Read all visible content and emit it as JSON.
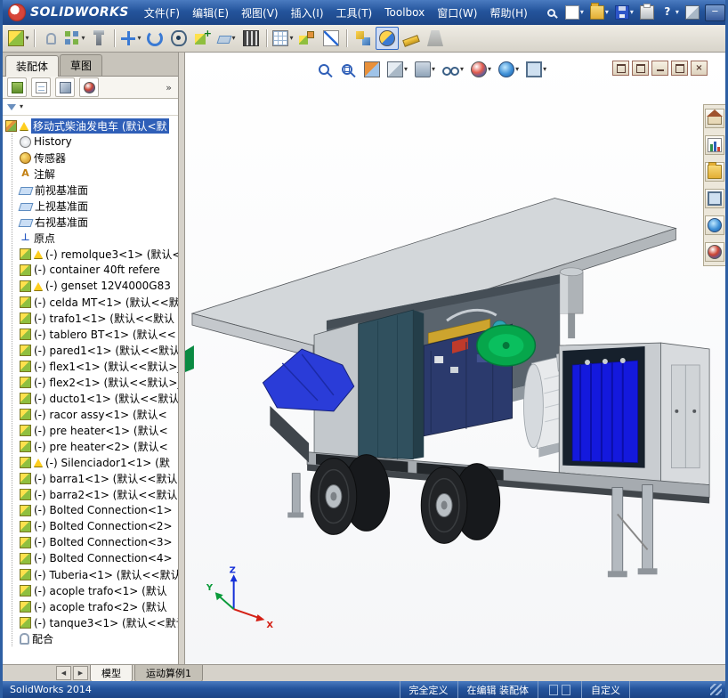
{
  "window": {
    "brand": "SOLIDWORKS",
    "menus": [
      "文件(F)",
      "编辑(E)",
      "视图(V)",
      "插入(I)",
      "工具(T)",
      "Toolbox",
      "窗口(W)",
      "帮助(H)"
    ],
    "quick_icons": [
      {
        "name": "search-icon",
        "kind": "search"
      },
      {
        "name": "new-document-icon",
        "kind": "page",
        "caret": true
      },
      {
        "name": "open-file-icon",
        "kind": "folder",
        "caret": true
      },
      {
        "name": "save-icon",
        "kind": "disk",
        "caret": true
      },
      {
        "name": "print-icon",
        "kind": "printer"
      },
      {
        "name": "help-icon",
        "kind": "help",
        "glyph": "?",
        "caret": true
      },
      {
        "name": "model-cube-icon",
        "kind": "cube"
      }
    ],
    "window_buttons": [
      {
        "name": "minimize-button",
        "glyph": "─"
      },
      {
        "name": "maximize-button",
        "glyph": "□"
      },
      {
        "name": "close-button",
        "glyph": "×"
      }
    ]
  },
  "icon_glyphs": {
    "caret": "▾",
    "overflow": "»",
    "scroll_left": "◀",
    "scroll_right": "▶",
    "origin": "⊥",
    "note": "A",
    "doc_close": "×"
  },
  "toolbar": {
    "items": [
      {
        "name": "insert-components-button",
        "kind": "part",
        "caret": true
      },
      {
        "sep": true
      },
      {
        "name": "mate-button",
        "kind": "clip"
      },
      {
        "name": "linear-component-pattern-button",
        "kind": "grid",
        "caret": true
      },
      {
        "name": "smart-fasteners-button",
        "kind": "bolt"
      },
      {
        "sep": true
      },
      {
        "name": "move-component-button",
        "kind": "cross",
        "caret": true
      },
      {
        "name": "rotate-component-button",
        "kind": "rotate"
      },
      {
        "name": "show-hidden-components-button",
        "kind": "eye"
      },
      {
        "name": "assembly-features-button",
        "kind": "cubeplus"
      },
      {
        "name": "reference-geometry-button",
        "kind": "plane",
        "caret": true
      },
      {
        "name": "new-motion-study-button",
        "kind": "film"
      },
      {
        "sep": true
      },
      {
        "name": "bill-of-materials-button",
        "kind": "table",
        "caret": true
      },
      {
        "name": "exploded-view-button",
        "kind": "explode"
      },
      {
        "name": "explode-line-sketch-button",
        "kind": "lines"
      },
      {
        "sep": true
      },
      {
        "name": "interference-detection-button",
        "kind": "cubes2"
      },
      {
        "name": "assembly-visualization-button",
        "kind": "vis",
        "active": true
      },
      {
        "name": "measure-button",
        "kind": "ruler"
      },
      {
        "name": "mass-properties-button",
        "kind": "weight",
        "disabled": true
      }
    ]
  },
  "left_panel": {
    "tabs": [
      {
        "label": "装配体",
        "active": true
      },
      {
        "label": "草图",
        "active": false
      }
    ],
    "manager_tabs": [
      {
        "name": "featuremanager-tree-tab",
        "kind": "tree"
      },
      {
        "name": "propertymanager-tab",
        "kind": "props"
      },
      {
        "name": "configurationmanager-tab",
        "kind": "config"
      },
      {
        "name": "displaymanager-tab",
        "kind": "sphere"
      }
    ]
  },
  "tree": {
    "items": [
      {
        "label": "移动式柴油发电车 (默认<默",
        "icon": "assy",
        "indent": 0,
        "warn": true,
        "selected": true
      },
      {
        "label": "History",
        "icon": "history",
        "indent": 1
      },
      {
        "label": "传感器",
        "icon": "sensor",
        "indent": 1
      },
      {
        "label": "注解",
        "icon": "note",
        "indent": 1
      },
      {
        "label": "前视基准面",
        "icon": "plane",
        "indent": 1
      },
      {
        "label": "上视基准面",
        "icon": "plane",
        "indent": 1
      },
      {
        "label": "右视基准面",
        "icon": "plane",
        "indent": 1
      },
      {
        "label": "原点",
        "icon": "origin",
        "indent": 1
      },
      {
        "label": "(-) remolque3<1> (默认<",
        "icon": "part",
        "indent": 1,
        "warn": true
      },
      {
        "label": "(-) container 40ft refere",
        "icon": "part",
        "indent": 1
      },
      {
        "label": "(-) genset 12V4000G83 ",
        "icon": "part",
        "indent": 1,
        "warn": true
      },
      {
        "label": "(-) celda MT<1> (默认<<默",
        "icon": "part",
        "indent": 1
      },
      {
        "label": "(-) trafo1<1> (默认<<默认",
        "icon": "part",
        "indent": 1
      },
      {
        "label": "(-) tablero BT<1> (默认<<",
        "icon": "part",
        "indent": 1
      },
      {
        "label": "(-) pared1<1> (默认<<默认",
        "icon": "part",
        "indent": 1
      },
      {
        "label": "(-) flex1<1> (默认<<默认>_",
        "icon": "part",
        "indent": 1
      },
      {
        "label": "(-) flex2<1> (默认<<默认>_",
        "icon": "part",
        "indent": 1
      },
      {
        "label": "(-) ducto1<1> (默认<<默认",
        "icon": "part",
        "indent": 1
      },
      {
        "label": "(-) racor assy<1> (默认<",
        "icon": "part",
        "indent": 1
      },
      {
        "label": "(-) pre heater<1> (默认<",
        "icon": "part",
        "indent": 1
      },
      {
        "label": "(-) pre heater<2> (默认<",
        "icon": "part",
        "indent": 1
      },
      {
        "label": "(-) Silenciador1<1> (默",
        "icon": "part",
        "indent": 1,
        "warn": true
      },
      {
        "label": "(-) barra1<1> (默认<<默认",
        "icon": "part",
        "indent": 1
      },
      {
        "label": "(-) barra2<1> (默认<<默认",
        "icon": "part",
        "indent": 1
      },
      {
        "label": "(-) Bolted Connection<1>",
        "icon": "part",
        "indent": 1
      },
      {
        "label": "(-) Bolted Connection<2>",
        "icon": "part",
        "indent": 1
      },
      {
        "label": "(-) Bolted Connection<3>",
        "icon": "part",
        "indent": 1
      },
      {
        "label": "(-) Bolted Connection<4>",
        "icon": "part",
        "indent": 1
      },
      {
        "label": "(-) Tuberia<1> (默认<<默认",
        "icon": "part",
        "indent": 1
      },
      {
        "label": "(-) acople trafo<1> (默认",
        "icon": "part",
        "indent": 1
      },
      {
        "label": "(-) acople trafo<2> (默认",
        "icon": "part",
        "indent": 1
      },
      {
        "label": "(-) tanque3<1> (默认<<默认",
        "icon": "part",
        "indent": 1
      },
      {
        "label": "配合",
        "icon": "mate",
        "indent": 1
      }
    ]
  },
  "viewport": {
    "headsup_icons": [
      {
        "name": "zoom-to-fit-icon",
        "kind": "magnifier"
      },
      {
        "name": "zoom-to-area-icon",
        "kind": "magnifier-area"
      },
      {
        "name": "section-view-icon",
        "kind": "section"
      },
      {
        "name": "view-orientation-icon",
        "kind": "cube",
        "caret": true
      },
      {
        "name": "display-style-icon",
        "kind": "dispstyle",
        "caret": true
      },
      {
        "name": "hide-show-items-icon",
        "kind": "glasses",
        "caret": true
      },
      {
        "name": "edit-appearance-icon",
        "kind": "ball",
        "caret": true
      },
      {
        "name": "apply-scene-icon",
        "kind": "globe",
        "caret": true
      },
      {
        "name": "view-settings-icon",
        "kind": "monitor",
        "caret": true
      }
    ],
    "window_buttons": [
      {
        "name": "doc-window-button-1",
        "type": "box"
      },
      {
        "name": "doc-window-button-2",
        "type": "box"
      },
      {
        "name": "doc-minimize-button",
        "type": "min"
      },
      {
        "name": "doc-restore-button",
        "type": "box"
      },
      {
        "name": "doc-close-button",
        "type": "close"
      }
    ],
    "taskpane_icons": [
      {
        "name": "solidworks-resources-icon",
        "kind": "house"
      },
      {
        "name": "design-library-icon",
        "kind": "chart"
      },
      {
        "name": "file-explorer-icon",
        "kind": "folder"
      },
      {
        "name": "view-palette-icon",
        "kind": "monitor"
      },
      {
        "name": "appearances-scenes-icon",
        "kind": "globe"
      },
      {
        "name": "custom-properties-icon",
        "kind": "sphere"
      }
    ],
    "triad": {
      "x": "X",
      "y": "Y",
      "z": "Z"
    }
  },
  "bottom_tabs": {
    "tabs": [
      {
        "label": "模型",
        "active": true
      },
      {
        "label": "运动算例1",
        "active": false
      }
    ]
  },
  "statusbar": {
    "app": "SolidWorks 2014",
    "segments": [
      "完全定义",
      "在编辑 装配体",
      "自定义"
    ]
  },
  "colors": {
    "titlebar_blue": "#24549c",
    "selection_blue": "#2f5fb8",
    "warning_yellow": "#ffce1f",
    "tarp_blue": "#2a3cd8",
    "transformer_blue": "#1419dd",
    "radiator_green": "#06a64b"
  }
}
